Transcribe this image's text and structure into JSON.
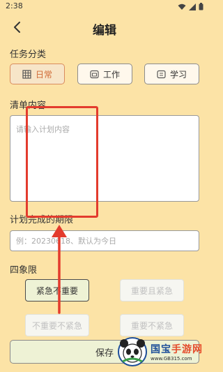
{
  "status": {
    "time": "2:38"
  },
  "header": {
    "title": "编辑"
  },
  "category": {
    "label": "任务分类",
    "items": [
      {
        "label": "日常",
        "icon": "calendar-grid-icon",
        "active": true
      },
      {
        "label": "工作",
        "icon": "briefcase-icon",
        "active": false
      },
      {
        "label": "学习",
        "icon": "monitor-icon",
        "active": false
      }
    ]
  },
  "content": {
    "label": "清单内容",
    "placeholder": "请输入计划内容"
  },
  "deadline": {
    "label": "计划完成的期限",
    "placeholder": "例：20230618、默认为今日"
  },
  "quadrant": {
    "label": "四象限",
    "options": [
      {
        "label": "紧急不重要",
        "active": true
      },
      {
        "label": "重要且紧急",
        "active": false
      },
      {
        "label": "不重要不紧急",
        "active": false
      },
      {
        "label": "重要不紧急",
        "active": false
      }
    ]
  },
  "save": {
    "label": "保存"
  },
  "watermark": {
    "brand_a": "国宝",
    "brand_b": "手游网",
    "url": "www.GB315.com"
  },
  "colors": {
    "background": "#FCE3A6",
    "accent": "#D06A36",
    "annotation": "#E33B2D"
  }
}
